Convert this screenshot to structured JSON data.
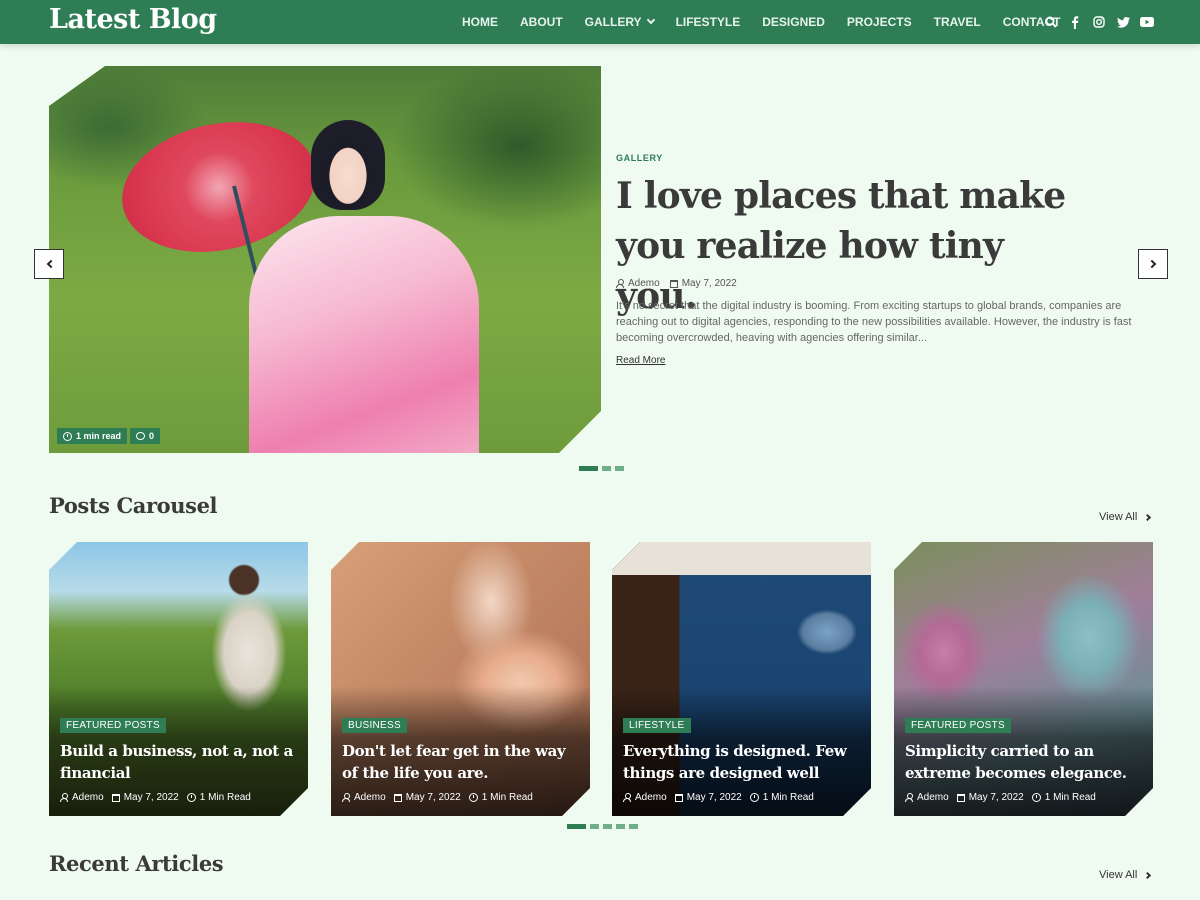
{
  "brand": {
    "logo": "Latest Blog",
    "accent": "#2e7d55",
    "background": "#effbf0"
  },
  "nav": {
    "items": [
      {
        "label": "HOME"
      },
      {
        "label": "ABOUT"
      },
      {
        "label": "GALLERY",
        "has_dropdown": true
      },
      {
        "label": "LIFESTYLE"
      },
      {
        "label": "DESIGNED"
      },
      {
        "label": "PROJECTS"
      },
      {
        "label": "TRAVEL"
      },
      {
        "label": "CONTACT"
      }
    ],
    "icons": [
      "search-icon",
      "facebook-icon",
      "instagram-icon",
      "twitter-icon",
      "youtube-icon"
    ]
  },
  "hero": {
    "category": "GALLERY",
    "title": "I love places that make you realize how tiny you.",
    "author": "Ademo",
    "date": "May 7, 2022",
    "excerpt": "It's no secret that the digital industry is booming. From exciting startups to global brands, companies are reaching out to digital agencies, responding to the new possibilities available. However, the industry is fast becoming overcrowded, heaving with agencies offering similar...",
    "read_more": "Read More",
    "read_time": "1 min read",
    "comments": "0",
    "slide_count": 3,
    "active_slide": 1
  },
  "carousel": {
    "title": "Posts Carousel",
    "view_all": "View All",
    "slide_count": 5,
    "active_slide": 1,
    "cards": [
      {
        "category": "FEATURED POSTS",
        "title": "Build a business, not a, not a financial",
        "author": "Ademo",
        "date": "May 7, 2022",
        "read_time": "1 Min Read"
      },
      {
        "category": "BUSINESS",
        "title": "Don't let fear get in the way of the life you are.",
        "author": "Ademo",
        "date": "May 7, 2022",
        "read_time": "1 Min Read"
      },
      {
        "category": "LIFESTYLE",
        "title": "Everything is designed. Few things are designed well",
        "author": "Ademo",
        "date": "May 7, 2022",
        "read_time": "1 Min Read"
      },
      {
        "category": "FEATURED POSTS",
        "title": "Simplicity carried to an extreme becomes elegance.",
        "author": "Ademo",
        "date": "May 7, 2022",
        "read_time": "1 Min Read"
      }
    ]
  },
  "recent": {
    "title": "Recent Articles",
    "view_all": "View All"
  }
}
